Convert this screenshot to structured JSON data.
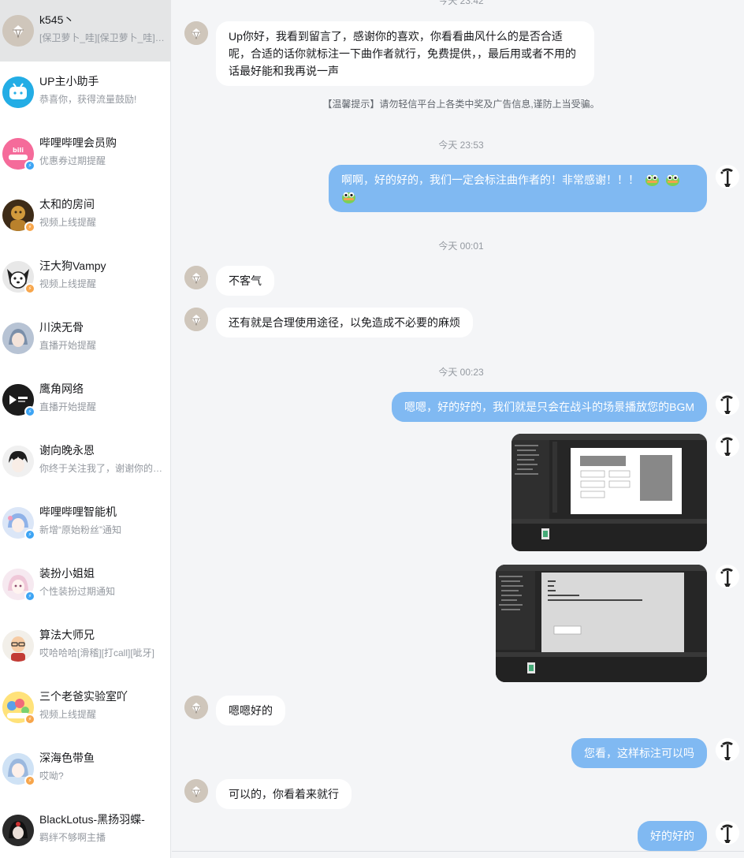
{
  "sidebar": {
    "conversations": [
      {
        "name": "k545丶",
        "preview": "[保卫萝卜_哇][保卫萝卜_哇][保卫萝卜_哇]",
        "badge": ""
      },
      {
        "name": "UP主小助手",
        "preview": "恭喜你，获得流量鼓励!",
        "badge": ""
      },
      {
        "name": "哔哩哔哩会员购",
        "preview": "优惠券过期提醒",
        "badge": "blue"
      },
      {
        "name": "太和的房间",
        "preview": "视频上线提醒",
        "badge": "orange"
      },
      {
        "name": "汪大狗Vampy",
        "preview": "视频上线提醒",
        "badge": "orange"
      },
      {
        "name": "川泱无骨",
        "preview": "直播开始提醒",
        "badge": ""
      },
      {
        "name": "鹰角网络",
        "preview": "直播开始提醒",
        "badge": "blue"
      },
      {
        "name": "谢向晚永恩",
        "preview": "你终于关注我了，谢谢你的关注",
        "badge": ""
      },
      {
        "name": "哔哩哔哩智能机",
        "preview": "新增“原始粉丝”通知",
        "badge": "blue"
      },
      {
        "name": "装扮小姐姐",
        "preview": "个性装扮过期通知",
        "badge": "blue"
      },
      {
        "name": "算法大师兄",
        "preview": "哎哈哈哈[滑稽][打call][呲牙]",
        "badge": ""
      },
      {
        "name": "三个老爸实验室吖",
        "preview": "视频上线提醒",
        "badge": "orange"
      },
      {
        "name": "深海色带鱼",
        "preview": "哎呦?",
        "badge": "orange"
      },
      {
        "name": "BlackLotus-黑扬羽蝶-",
        "preview": "羁绊不够啊主播",
        "badge": ""
      }
    ]
  },
  "chat": {
    "top_time_partial": "今天 23:42",
    "messages": [
      {
        "type": "text",
        "side": "in",
        "text": "Up你好，我看到留言了，感谢你的喜欢，你看看曲风什么的是否合适呢，合适的话你就标注一下曲作者就行，免费提供，，最后用或者不用的话最好能和我再说一声"
      },
      {
        "type": "notice",
        "text": "【温馨提示】请勿轻信平台上各类中奖及广告信息,谨防上当受骗。"
      },
      {
        "type": "time",
        "text": "今天 23:53"
      },
      {
        "type": "text",
        "side": "out",
        "text": "啊啊，好的好的，我们一定会标注曲作者的！非常感谢！！！"
      },
      {
        "type": "time",
        "text": "今天 00:01"
      },
      {
        "type": "text",
        "side": "in",
        "text": "不客气"
      },
      {
        "type": "text",
        "side": "in",
        "text": "还有就是合理使用途径，以免造成不必要的麻烦"
      },
      {
        "type": "time",
        "text": "今天 00:23"
      },
      {
        "type": "text",
        "side": "out",
        "text": "嗯嗯，好的好的，我们就是只会在战斗的场景播放您的BGM"
      },
      {
        "type": "image",
        "side": "out",
        "alt": "screenshot-1"
      },
      {
        "type": "image",
        "side": "out",
        "alt": "screenshot-2"
      },
      {
        "type": "text",
        "side": "in",
        "text": "嗯嗯好的"
      },
      {
        "type": "text",
        "side": "out",
        "text": "您看，这样标注可以吗"
      },
      {
        "type": "text",
        "side": "in",
        "text": "可以的，你看着来就行"
      },
      {
        "type": "text",
        "side": "out",
        "text": "好的好的"
      }
    ]
  },
  "colors": {
    "out_bubble": "#80b9f2",
    "in_bubble": "#ffffff",
    "chat_bg": "#f4f5f7",
    "active_conv": "#e4e5e6",
    "badge_blue": "#3ca4f4",
    "badge_orange": "#f7a54a"
  },
  "icons": {
    "emoji": "green-frog-emoji",
    "left_avatar": "diamond-avatar",
    "right_avatar": "anime-character-avatar"
  }
}
